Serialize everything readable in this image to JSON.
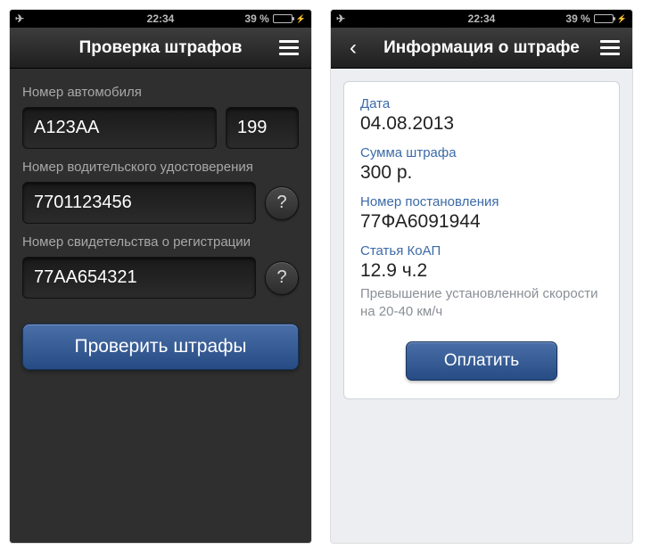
{
  "statusbar": {
    "time": "22:34",
    "battery_text": "39 %"
  },
  "left": {
    "title": "Проверка штрафов",
    "labels": {
      "car_number": "Номер автомобиля",
      "driver_license": "Номер водительского удостоверения",
      "registration": "Номер свидетельства о регистрации"
    },
    "fields": {
      "plate": "А123АА",
      "region": "199",
      "license": "7701123456",
      "registration": "77АА654321"
    },
    "help": "?",
    "submit": "Проверить штрафы"
  },
  "right": {
    "title": "Информация о штрафе",
    "labels": {
      "date": "Дата",
      "amount": "Сумма штрафа",
      "order_number": "Номер постановления",
      "article": "Статья КоАП"
    },
    "values": {
      "date": "04.08.2013",
      "amount": "300 р.",
      "order_number": "77ФА6091944",
      "article": "12.9 ч.2"
    },
    "description": "Превышение установленной скорости на 20-40 км/ч",
    "pay": "Оплатить"
  }
}
